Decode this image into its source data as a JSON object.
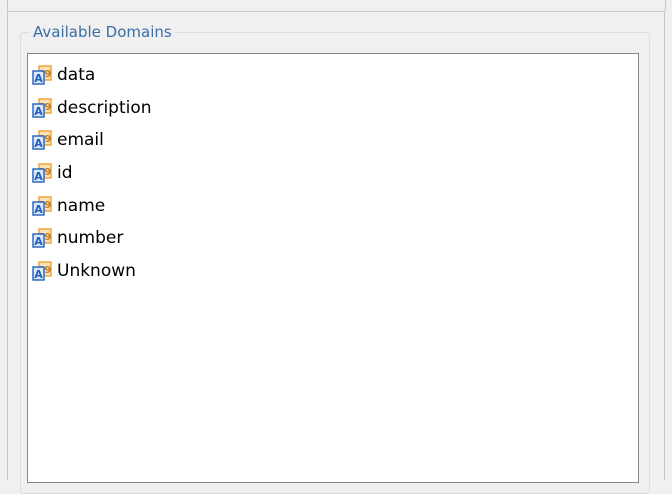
{
  "panel": {
    "title": "Available Domains"
  },
  "domains": [
    {
      "label": "data",
      "icon": "domain-type-icon"
    },
    {
      "label": "description",
      "icon": "domain-type-icon"
    },
    {
      "label": "email",
      "icon": "domain-type-icon"
    },
    {
      "label": "id",
      "icon": "domain-type-icon"
    },
    {
      "label": "name",
      "icon": "domain-type-icon"
    },
    {
      "label": "number",
      "icon": "domain-type-icon"
    },
    {
      "label": "Unknown",
      "icon": "domain-type-icon"
    }
  ],
  "colors": {
    "legend_text": "#3a6ea5",
    "icon_blue": "#1f5fbf",
    "icon_orange": "#f0a030",
    "list_border": "#828790"
  }
}
